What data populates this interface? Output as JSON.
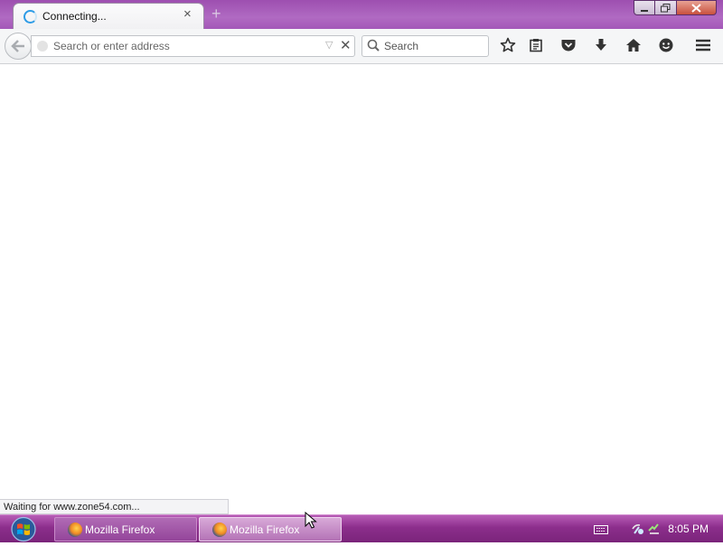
{
  "browser": {
    "tab": {
      "title": "Connecting...",
      "close_label": "×"
    },
    "new_tab_label": "+",
    "window_controls": {
      "minimize": "–",
      "maximize": "❐",
      "close": "✕"
    },
    "navigation": {
      "address_placeholder": "Search or enter address",
      "address_value": "",
      "search_placeholder": "Search",
      "search_value": ""
    },
    "toolbar_icons": [
      "star-icon",
      "reading-list-icon",
      "pocket-icon",
      "download-icon",
      "home-icon",
      "chat-icon",
      "menu-icon"
    ],
    "status_text": "Waiting for www.zone54.com..."
  },
  "taskbar": {
    "items": [
      {
        "label": "Mozilla Firefox",
        "active": false
      },
      {
        "label": "Mozilla Firefox",
        "active": true
      }
    ],
    "clock": "8:05 PM"
  },
  "colors": {
    "title_bar": "#a457b8",
    "taskbar": "#8c2e8c",
    "spinner": "#2f9ce6"
  }
}
